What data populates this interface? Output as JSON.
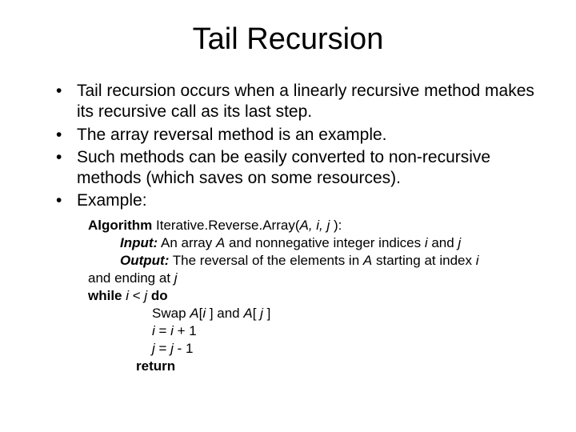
{
  "title": "Tail Recursion",
  "bullets": [
    "Tail recursion occurs when a linearly recursive method makes its recursive call as its last step.",
    "The array reversal method is an example.",
    "Such methods can be easily converted to non-recursive methods (which saves on some resources).",
    "Example:"
  ],
  "algo": {
    "sig_prefix": "Algorithm ",
    "sig_name": "Iterative.Reverse.Array(",
    "sig_args": "A, i, j ",
    "sig_close": "):",
    "input_label": "Input:",
    "input_a": " An array ",
    "input_b": "A",
    "input_c": " and nonnegative integer indices ",
    "input_d": "i",
    "input_e": " and ",
    "input_f": "j",
    "output_label": "Output:",
    "output_a": " The reversal of the elements in ",
    "output_b": "A",
    "output_c": " starting at index ",
    "output_d": "i",
    "endat_a": "and ending at ",
    "endat_b": "j",
    "while_a": "while ",
    "while_b": "i ",
    "while_c": " < ",
    "while_d": " j",
    "while_e": " do",
    "swap_a": "Swap ",
    "swap_b": "A",
    "swap_c": "[",
    "swap_d": "i ",
    "swap_e": "] and ",
    "swap_f": "A",
    "swap_g": "[ ",
    "swap_h": "j ",
    "swap_i": "]",
    "inc_a": "i ",
    "inc_b": " = ",
    "inc_c": "i ",
    "inc_d": "+ 1",
    "dec_a": "j ",
    "dec_b": " = ",
    "dec_c": "j ",
    "dec_d": "- 1",
    "return": "return"
  }
}
